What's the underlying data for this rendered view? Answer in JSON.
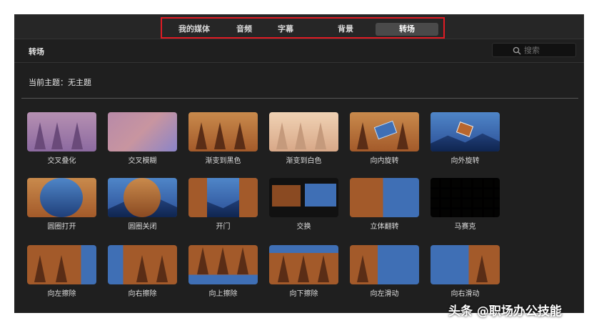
{
  "tabs": [
    "我的媒体",
    "音频",
    "字幕",
    "背景",
    "转场"
  ],
  "active_tab": "转场",
  "section_title": "转场",
  "search": {
    "placeholder": "搜索"
  },
  "theme": "当前主题：无主题",
  "transitions": [
    "交叉叠化",
    "交叉模糊",
    "渐变到黑色",
    "渐变到白色",
    "向内旋转",
    "向外旋转",
    "圆圈打开",
    "圆圈关闭",
    "开门",
    "交换",
    "立体翻转",
    "马赛克",
    "向左擦除",
    "向右擦除",
    "向上擦除",
    "向下擦除",
    "向左滑动",
    "向右滑动"
  ],
  "watermark": "头条 @职场办公技能",
  "colors": {
    "highlight": "#e01b24",
    "background": "#1f1f1f",
    "active_tab": "#4a4a4a"
  }
}
